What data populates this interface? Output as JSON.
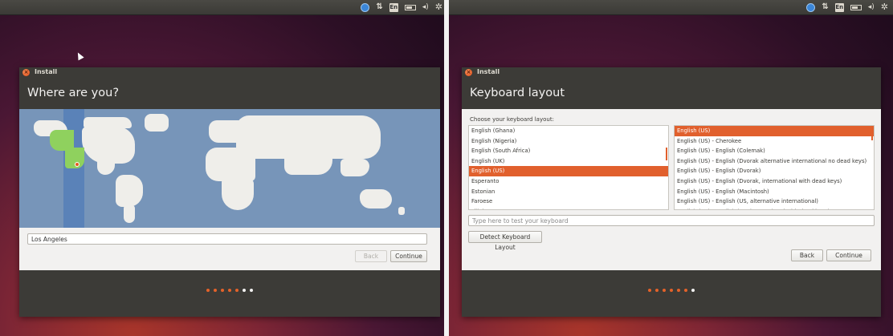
{
  "colors": {
    "accent": "#e1602d",
    "window_dark": "#3c3b37",
    "map_water": "#7795b9"
  },
  "indicators": {
    "keyboard": "En",
    "network": "⇅",
    "volume": "◂)",
    "gear": "✲"
  },
  "left": {
    "window_title": "Install",
    "heading": "Where are you?",
    "location_value": "Los Angeles",
    "back_label": "Back",
    "continue_label": "Continue",
    "progress": {
      "total": 7,
      "current": 6
    }
  },
  "right": {
    "window_title": "Install",
    "heading": "Keyboard layout",
    "choose_label": "Choose your keyboard layout:",
    "layouts": [
      "English (Ghana)",
      "English (Nigeria)",
      "English (South Africa)",
      "English (UK)",
      "English (US)",
      "Esperanto",
      "Estonian",
      "Faroese",
      "Filipino"
    ],
    "layouts_selected": 4,
    "variants": [
      "English (US)",
      "English (US) - Cherokee",
      "English (US) - English (Colemak)",
      "English (US) - English (Dvorak alternative international no dead keys)",
      "English (US) - English (Dvorak)",
      "English (US) - English (Dvorak, international with dead keys)",
      "English (US) - English (Macintosh)",
      "English (US) - English (US, alternative international)",
      "English (US) - English (US, international with dead keys)"
    ],
    "variants_selected": 0,
    "test_placeholder": "Type here to test your keyboard",
    "detect_label": "Detect Keyboard Layout",
    "back_label": "Back",
    "continue_label": "Continue",
    "progress": {
      "total": 7,
      "current": 7
    }
  }
}
